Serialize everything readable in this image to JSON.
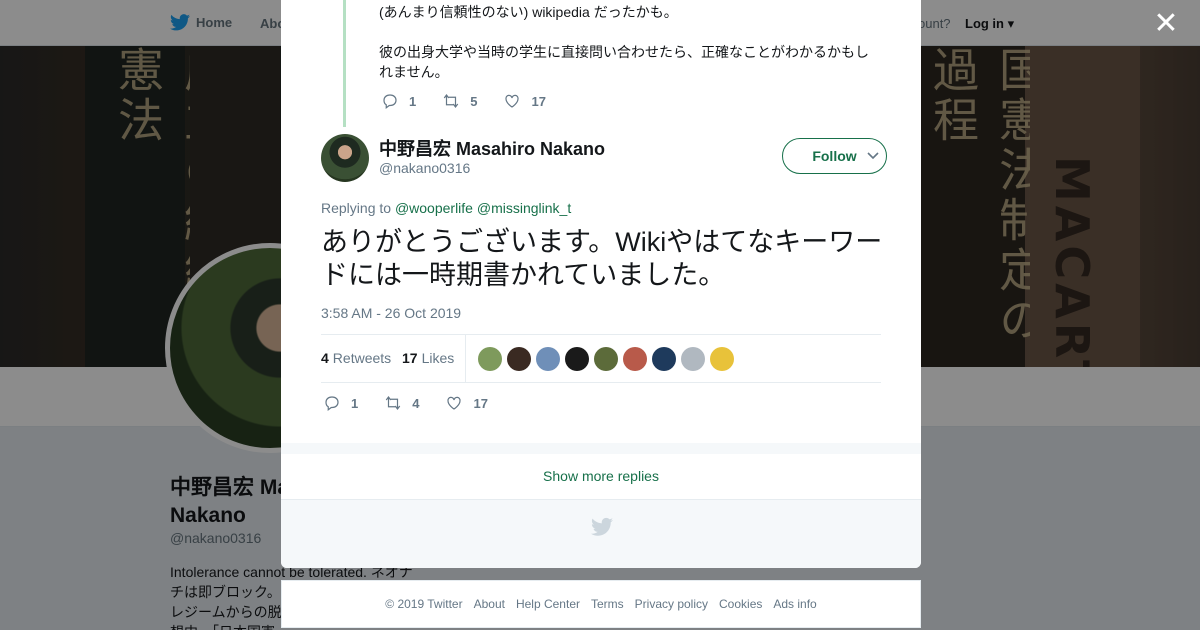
{
  "nav": {
    "home_label": "Home",
    "about_label": "Abo",
    "account_prompt": "ccount?",
    "login_label": "Log in"
  },
  "banner": {
    "spine_left": "成立の経緯と憲法",
    "spine_right": "国憲法制定の過程",
    "spine_far": "MACART"
  },
  "background_profile": {
    "name": "中野昌宏 Ma\nNakano",
    "handle": "@nakano0316",
    "bio_lines": [
      "Intolerance cannot be tolerated. ネオナ",
      "チは即ブロック。",
      "レジームからの脱",
      "想中。「日本国憲"
    ]
  },
  "modal": {
    "previous_tweet": {
      "line1": "(あんまり信頼性のない) wikipedia だったかも。",
      "line2": "彼の出身大学や当時の学生に直接問い合わせたら、正確なことがわかるかもしれません。",
      "replies": "1",
      "retweets": "5",
      "likes": "17"
    },
    "author": {
      "name": "中野昌宏 Masahiro Nakano",
      "handle": "@nakano0316",
      "follow_label": "Follow"
    },
    "replying_prefix": "Replying to",
    "replying_to": [
      "@wooperlife",
      "@missinglink_t"
    ],
    "tweet_text": "ありがとうございます。Wikiやはてなキーワードには一時期書かれていました。",
    "timestamp": "3:58 AM - 26 Oct 2019",
    "stats": {
      "retweets_count": "4",
      "retweets_label": "Retweets",
      "likes_count": "17",
      "likes_label": "Likes"
    },
    "liker_colors": [
      "#7e9a5c",
      "#3a2a22",
      "#6f8fb8",
      "#1a1a1a",
      "#5c6b3a",
      "#b85a4a",
      "#1e3a5c",
      "#b0b8c0",
      "#e8c23a"
    ],
    "actions": {
      "replies": "1",
      "retweets": "4",
      "likes": "17"
    },
    "show_more_label": "Show more replies"
  },
  "footer": {
    "links": [
      "© 2019 Twitter",
      "About",
      "Help Center",
      "Terms",
      "Privacy policy",
      "Cookies",
      "Ads info"
    ]
  },
  "colors": {
    "accent": "#17704a",
    "thread_line": "#b5e0c3",
    "muted": "#657786"
  },
  "icons": {
    "close": "close-icon",
    "reply": "reply-icon",
    "retweet": "retweet-icon",
    "like": "heart-icon",
    "caret": "chevron-down-icon",
    "brand": "twitter-bird-icon"
  }
}
